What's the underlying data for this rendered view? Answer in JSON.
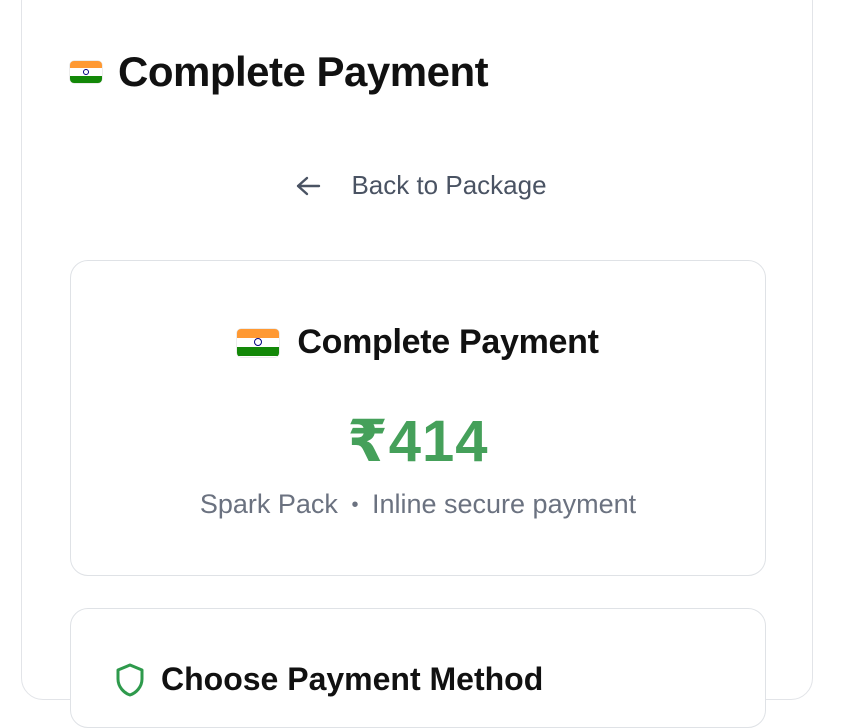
{
  "page": {
    "title": "Complete Payment",
    "flag_icon": "india-flag-icon"
  },
  "navigation": {
    "back_label": "Back to Package",
    "back_icon": "arrow-left-icon"
  },
  "summary": {
    "title": "Complete Payment",
    "amount": "₹414",
    "package_name": "Spark Pack",
    "separator": "•",
    "payment_note": "Inline secure payment",
    "amount_color": "#45a05a"
  },
  "payment_method": {
    "title": "Choose Payment Method",
    "icon": "shield-icon",
    "icon_color": "#2e9a4c"
  }
}
